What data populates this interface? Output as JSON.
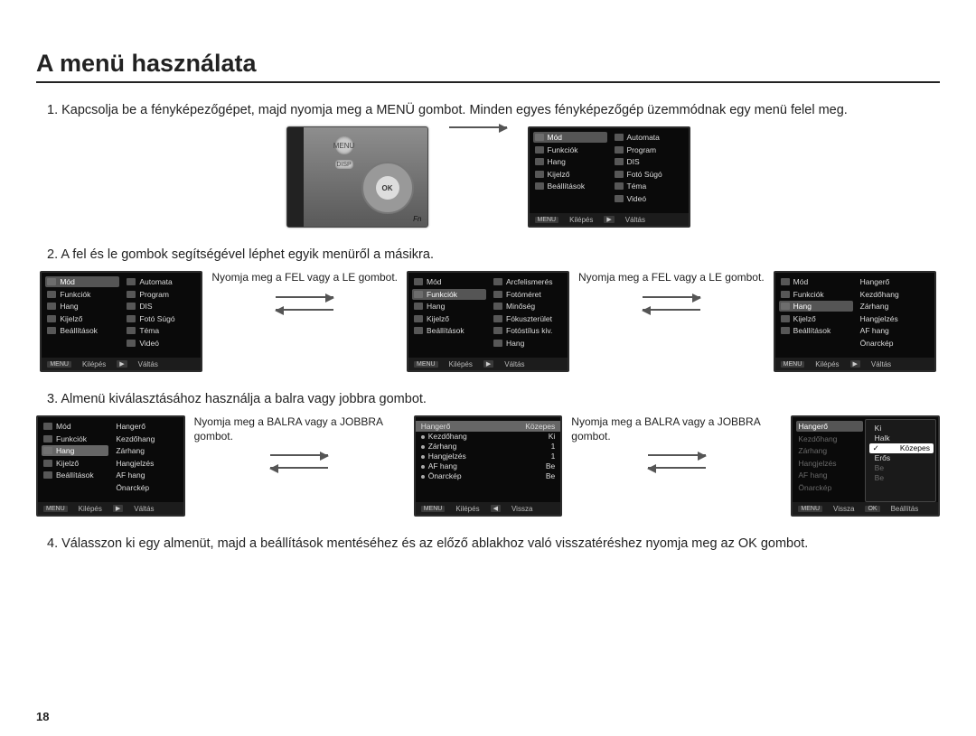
{
  "page_title": "A menü használata",
  "page_number": "18",
  "steps": {
    "s1": "1. Kapcsolja be a fényképezőgépet, majd nyomja meg a MENÜ gombot. Minden egyes fényképezőgép üzemmódnak egy menü felel meg.",
    "s2": "2. A fel és le gombok segítségével léphet egyik menüről a másikra.",
    "s3": "3. Almenü kiválasztásához használja a balra vagy jobbra gombot.",
    "s4": "4. Válasszon ki egy almenüt, majd a beállítások mentéséhez és az előző ablakhoz való visszatéréshez nyomja meg az OK gombot."
  },
  "captions": {
    "updown": "Nyomja meg a FEL vagy a LE gombot.",
    "leftright": "Nyomja meg a BALRA vagy a JOBBRA gombot."
  },
  "camera_labels": {
    "menu": "MENU",
    "disp": "DISP",
    "ok": "OK",
    "fn": "Fn"
  },
  "footer": {
    "menu": "MENU",
    "exit": "Kilépés",
    "ok": "OK",
    "switch": "Váltás",
    "back": "Vissza",
    "set": "Beállítás"
  },
  "menu_left": {
    "mod": "Mód",
    "funkciok": "Funkciók",
    "hang": "Hang",
    "kijelzo": "Kijelző",
    "beallitasok": "Beállítások"
  },
  "menu_right_mode": {
    "automata": "Automata",
    "program": "Program",
    "dis": "DIS",
    "foto_sugo": "Fotó Súgó",
    "tema": "Téma",
    "video": "Videó"
  },
  "menu_right_funkciok": {
    "arcfelismeres": "Arcfelismerés",
    "fotomeret": "Fotóméret",
    "minoseg": "Minőség",
    "fokusz": "Fókuszterület",
    "fotostilus": "Fotóstílus kiv.",
    "hang2": "Hang"
  },
  "menu_right_hang": {
    "hangero": "Hangerő",
    "kezdohang": "Kezdőhang",
    "zarhang": "Zárhang",
    "hangjelzes": "Hangjelzés",
    "af_hang": "AF hang",
    "onarckep": "Önarckép"
  },
  "menu3_middle": {
    "hangero": "Hangerő",
    "hangero_val": "Közepes",
    "kezdohang": "Kezdőhang",
    "kezdohang_val": "Ki",
    "zarhang": "Zárhang",
    "zarhang_val": "1",
    "hangjelzes": "Hangjelzés",
    "hangjelzes_val": "1",
    "af_hang": "AF hang",
    "af_hang_val": "Be",
    "onarckep": "Önarckép",
    "onarckep_val": "Be"
  },
  "menu3_right": {
    "ki": "Ki",
    "halk": "Halk",
    "kozepes": "Közepes",
    "eros": "Erős"
  }
}
